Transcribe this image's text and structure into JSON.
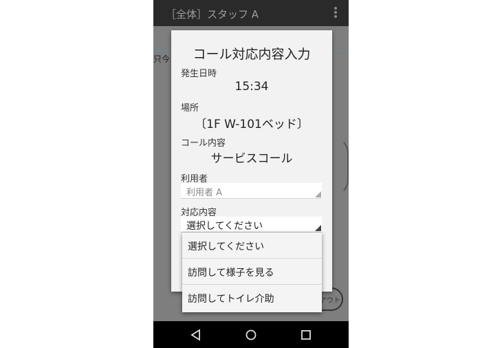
{
  "appbar": {
    "title": "［全体］スタッフ A",
    "menu_icon": "overflow-menu-icon"
  },
  "background": {
    "partial_text": "只今",
    "logout_partial": "アウト"
  },
  "dialog": {
    "title": "コール対応内容入力",
    "occurred_label": "発生日時",
    "occurred_value": "15:34",
    "place_label": "場所",
    "place_value": "〔1F W-101ベッド〕",
    "call_label": "コール内容",
    "call_value": "サービスコール",
    "user_label": "利用者",
    "user_value": "利用者 A",
    "response_label": "対応内容",
    "response_selected": "選択してください"
  },
  "dropdown": {
    "options": [
      "選択してください",
      "訪問して様子を見る",
      "訪問してトイレ介助"
    ]
  },
  "navbar": {
    "back_icon": "back-icon",
    "home_icon": "home-icon",
    "recents_icon": "recents-icon"
  }
}
